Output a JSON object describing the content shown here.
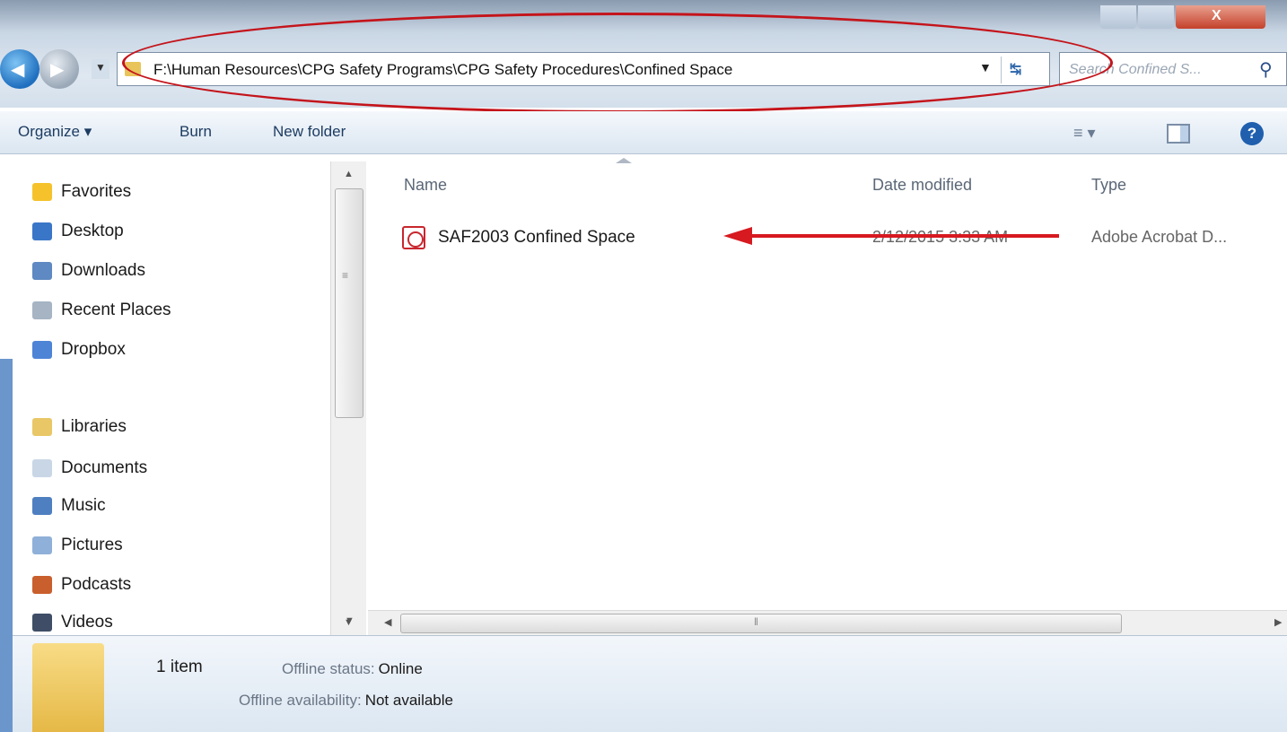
{
  "window": {
    "close_glyph": "X"
  },
  "address_bar": {
    "path": "F:\\Human Resources\\CPG Safety Programs\\CPG Safety Procedures\\Confined Space",
    "dropdown_glyph": "▼",
    "refresh_glyph": "↹",
    "annotation_color": "#c4141b"
  },
  "search": {
    "placeholder": "Search Confined S..."
  },
  "command_bar": {
    "organize": "Organize ▾",
    "burn": "Burn",
    "new_folder": "New folder",
    "views_glyph": "≡ ▾",
    "help_glyph": "?"
  },
  "nav_pane": {
    "items": [
      {
        "label": "Favorites",
        "icon": "star-icon"
      },
      {
        "label": "Desktop",
        "icon": "desktop-icon"
      },
      {
        "label": "Downloads",
        "icon": "downloads-icon"
      },
      {
        "label": "Recent Places",
        "icon": "recent-places-icon"
      },
      {
        "label": "Dropbox",
        "icon": "dropbox-icon"
      },
      {
        "label": "Libraries",
        "icon": "libraries-icon"
      },
      {
        "label": "Documents",
        "icon": "documents-icon"
      },
      {
        "label": "Music",
        "icon": "music-icon"
      },
      {
        "label": "Pictures",
        "icon": "pictures-icon"
      },
      {
        "label": "Podcasts",
        "icon": "podcasts-icon"
      },
      {
        "label": "Videos",
        "icon": "videos-icon"
      }
    ]
  },
  "file_list": {
    "columns": [
      "Name",
      "Date modified",
      "Type"
    ],
    "rows": [
      {
        "name": "SAF2003 Confined Space",
        "date": "2/12/2015 3:33 AM",
        "type": "Adobe Acrobat D..."
      }
    ],
    "annotation_color": "#d71920"
  },
  "details": {
    "count": "1 item",
    "offline_status_key": "Offline status:",
    "offline_status_value": "Online",
    "offline_availability_key": "Offline availability:",
    "offline_availability_value": "Not available"
  }
}
